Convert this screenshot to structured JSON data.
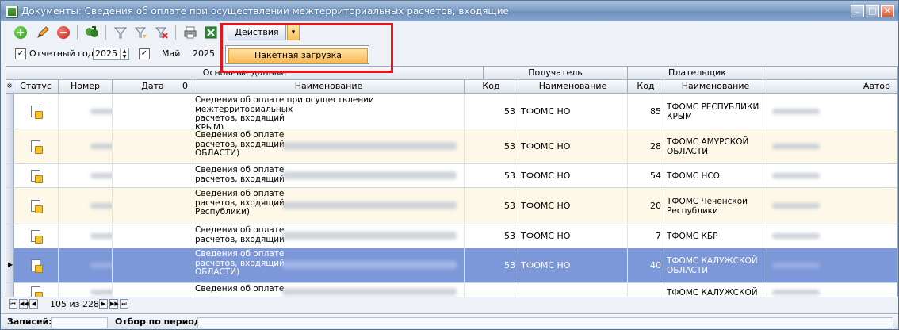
{
  "window": {
    "title": "Документы: Сведения об оплате при осуществлении межтерриториальных расчетов, входящие"
  },
  "toolbar": {
    "actions_label": "Действия",
    "menu_item": "Пакетная загрузка"
  },
  "filter": {
    "year_label": "Отчетный год:",
    "year_value": "2025",
    "month_value": "Май",
    "month_year": "2025"
  },
  "grid": {
    "groups": {
      "main": "Основные данные",
      "recipient": "Получатель",
      "payer": "Плательщик"
    },
    "columns": {
      "status": "Статус",
      "number": "Номер",
      "date": "Дата",
      "date_sort_mark": "0",
      "name": "Наименование",
      "r_code": "Код",
      "r_name": "Наименование",
      "p_code": "Код",
      "p_name": "Наименование",
      "author": "Автор",
      "row_marker": "※"
    },
    "rows": [
      {
        "name": "Сведения об оплате при осуществлении межтерриториальных расчетов, входящий ████████ КРЫМ)",
        "name_l1": "Сведения об оплате при осуществлении межтерриториальных",
        "name_l2": "расчетов, входящий",
        "name_l3": "КРЫМ)",
        "r_code": "53",
        "r_name": "ТФОМС НО",
        "p_code": "85",
        "p_name": "ТФОМС РЕСПУБЛИКИ КРЫМ"
      },
      {
        "name_l1": "Сведения об оплате",
        "name_l2": "расчетов, входящий",
        "name_l3": "ОБЛАСТИ)",
        "r_code": "53",
        "r_name": "ТФОМС НО",
        "p_code": "28",
        "p_name": "ТФОМС АМУРСКОЙ ОБЛАСТИ"
      },
      {
        "name_l1": "Сведения об оплате",
        "name_l2": "расчетов, входящий",
        "name_l3": "",
        "r_code": "53",
        "r_name": "ТФОМС НО",
        "p_code": "54",
        "p_name": "ТФОМС НСО"
      },
      {
        "name_l1": "Сведения об оплате",
        "name_l2": "расчетов, входящий",
        "name_l3": "Республики)",
        "r_code": "53",
        "r_name": "ТФОМС НО",
        "p_code": "20",
        "p_name": "ТФОМС Чеченской Республики"
      },
      {
        "name_l1": "Сведения об оплате",
        "name_l2": "расчетов, входящий",
        "name_l3": "",
        "r_code": "53",
        "r_name": "ТФОМС НО",
        "p_code": "7",
        "p_name": "ТФОМС КБР"
      },
      {
        "name_l1": "Сведения об оплате",
        "name_l2": "расчетов, входящий",
        "name_l3": "ОБЛАСТИ)",
        "r_code": "53",
        "r_name": "ТФОМС НО",
        "p_code": "40",
        "p_name": "ТФОМС КАЛУЖСКОЙ ОБЛАСТИ"
      },
      {
        "name_l1": "Сведения об оплате",
        "name_l2": "",
        "name_l3": "",
        "r_code": "",
        "r_name": "",
        "p_code": "",
        "p_name": "ТФОМС КАЛУЖСКОЙ"
      }
    ]
  },
  "pager": {
    "position": "105 из 228"
  },
  "status": {
    "records_label": "Записей:",
    "filter_label": "Отбор по периоду:"
  },
  "colors": {
    "selection": "#7d98d8",
    "row_alt": "#fdf8e8",
    "accent_red": "#e8141a",
    "highlight": "#f7b85a"
  }
}
